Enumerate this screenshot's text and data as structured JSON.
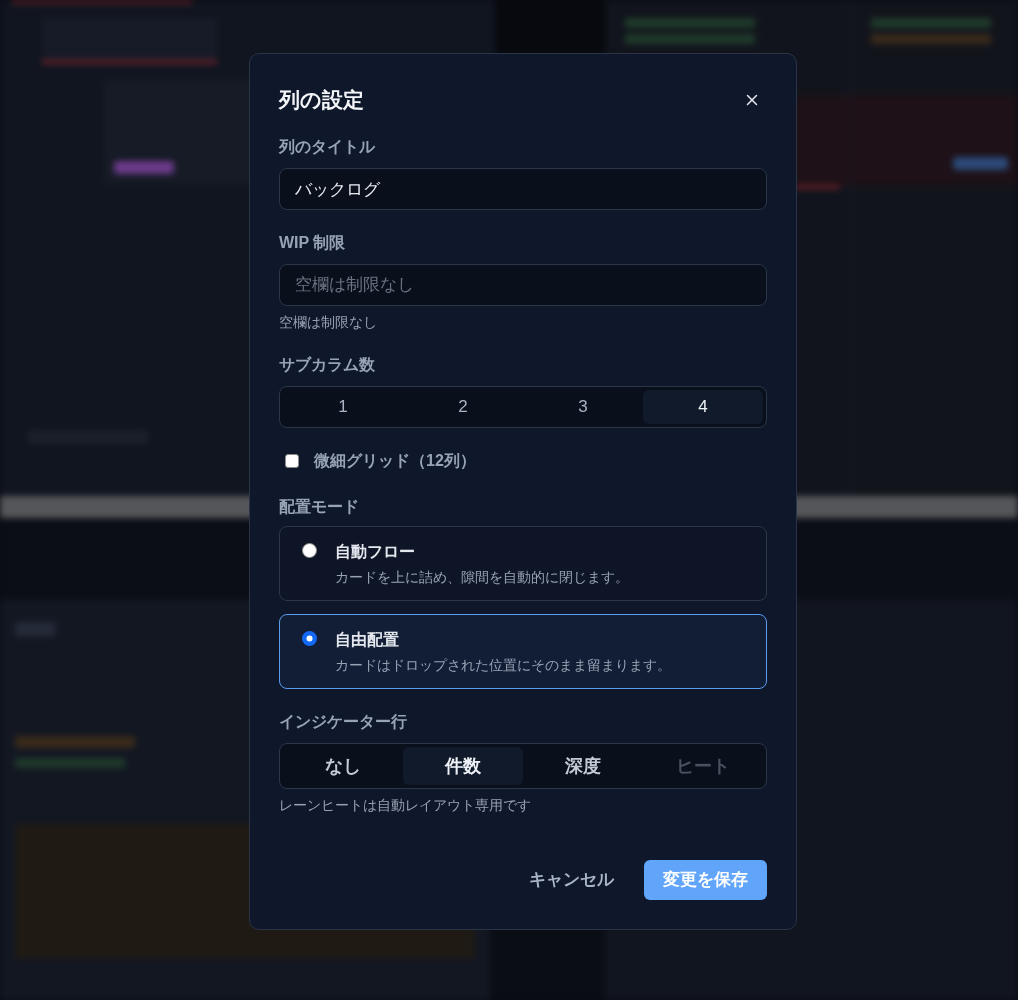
{
  "dialog": {
    "title": "列の設定",
    "fields": [
      {
        "kind": "text_input",
        "label": "列のタイトル",
        "value": "バックログ"
      },
      {
        "kind": "text_input",
        "label": "WIP 制限",
        "placeholder": "空欄は制限なし",
        "hint": "空欄は制限なし"
      },
      {
        "kind": "segmented",
        "label": "サブカラム数",
        "options": [
          {
            "label": "1",
            "selected": false
          },
          {
            "label": "2",
            "selected": false
          },
          {
            "label": "3",
            "selected": false
          },
          {
            "label": "4",
            "selected": true
          }
        ]
      },
      {
        "kind": "checkbox",
        "label": "微細グリッド（12列）",
        "checked": false
      },
      {
        "kind": "radio_cards",
        "label": "配置モード",
        "options": [
          {
            "title": "自動フロー",
            "description": "カードを上に詰め、隙間を自動的に閉じます。",
            "selected": false
          },
          {
            "title": "自由配置",
            "description": "カードはドロップされた位置にそのまま留まります。",
            "selected": true
          }
        ]
      },
      {
        "kind": "bold_segmented",
        "label": "インジケーター行",
        "options": [
          {
            "label": "なし",
            "selected": false,
            "disabled": false
          },
          {
            "label": "件数",
            "selected": true,
            "disabled": false
          },
          {
            "label": "深度",
            "selected": false,
            "disabled": false
          },
          {
            "label": "ヒート",
            "selected": false,
            "disabled": true
          }
        ],
        "hint": "レーンヒートは自動レイアウト専用です"
      }
    ],
    "buttons": [
      {
        "kind": "secondary",
        "label": "キャンセル"
      },
      {
        "kind": "primary",
        "label": "変更を保存"
      }
    ]
  }
}
